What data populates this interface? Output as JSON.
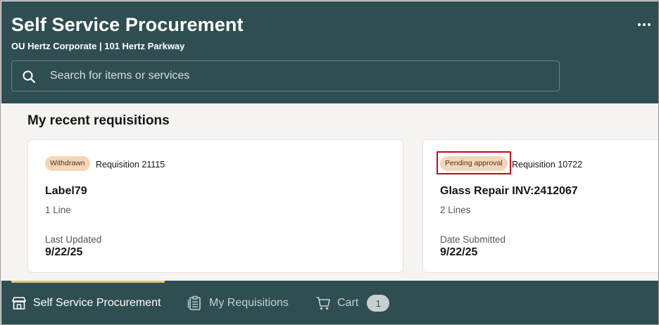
{
  "header": {
    "title": "Self Service Procurement",
    "subtitle": "OU Hertz Corporate | 101 Hertz Parkway",
    "more_icon": "more-horizontal-icon"
  },
  "search": {
    "placeholder": "Search for items or services",
    "value": "",
    "icon": "search-icon"
  },
  "recent": {
    "title": "My recent requisitions",
    "cards": [
      {
        "status": "Withdrawn",
        "requisition": "Requisition 21115",
        "title": "Label79",
        "lines": "1 Line",
        "date_label": "Last Updated",
        "date": "9/22/25"
      },
      {
        "status": "Pending approval",
        "requisition": "Requisition 10722",
        "title": "Glass Repair INV:2412067",
        "lines": "2 Lines",
        "date_label": "Date Submitted",
        "date": "9/22/25"
      }
    ]
  },
  "nav": {
    "items": [
      {
        "label": "Self Service Procurement",
        "icon": "storefront-icon",
        "active": true
      },
      {
        "label": "My Requisitions",
        "icon": "clipboard-list-icon",
        "active": false
      },
      {
        "label": "Cart",
        "icon": "cart-icon",
        "active": false,
        "count": "1"
      }
    ]
  },
  "colors": {
    "header_bg": "#2f4e51",
    "badge_bg": "#f6d6b8",
    "active_tab": "#e8c36a",
    "highlight": "#d0021b"
  }
}
